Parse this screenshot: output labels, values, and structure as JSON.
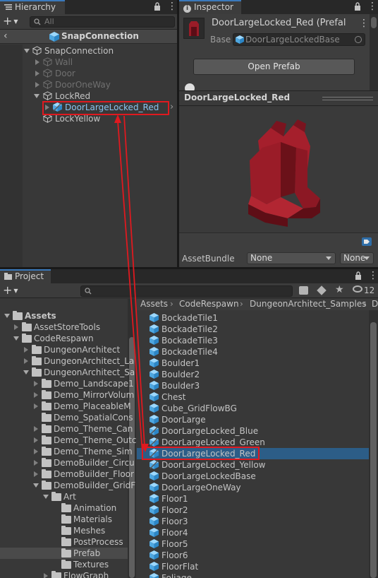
{
  "hierarchy": {
    "tab_label": "Hierarchy",
    "search_placeholder": "All",
    "scene_title": "SnapConnection",
    "items": [
      {
        "label": "SnapConnection"
      },
      {
        "label": "Wall"
      },
      {
        "label": "Door"
      },
      {
        "label": "DoorOneWay"
      },
      {
        "label": "LockRed"
      },
      {
        "label": "DoorLargeLocked_Red"
      },
      {
        "label": "LockYellow"
      }
    ]
  },
  "inspector": {
    "tab_label": "Inspector",
    "object_name": "DoorLargeLocked_Red (Prefal",
    "base_label": "Base",
    "base_value": "DoorLargeLockedBase",
    "open_prefab_label": "Open Prefab",
    "preview_title": "DoorLargeLocked_Red",
    "assetbundle_label": "AssetBundle",
    "assetbundle_value": "None",
    "variant_value": "None"
  },
  "project": {
    "tab_label": "Project",
    "hidden_count": "12",
    "breadcrumb": [
      "Assets",
      "CodeRespawn",
      "DungeonArchitect_Samples",
      "D"
    ],
    "tree": [
      {
        "label": "Assets",
        "bold": true
      },
      {
        "label": "AssetStoreTools"
      },
      {
        "label": "CodeRespawn"
      },
      {
        "label": "DungeonArchitect"
      },
      {
        "label": "DungeonArchitect_La"
      },
      {
        "label": "DungeonArchitect_Sa"
      },
      {
        "label": "Demo_Landscape1"
      },
      {
        "label": "Demo_MirrorVolum"
      },
      {
        "label": "Demo_PlaceableM"
      },
      {
        "label": "Demo_SpatialCons"
      },
      {
        "label": "Demo_Theme_Can"
      },
      {
        "label": "Demo_Theme_Outc"
      },
      {
        "label": "Demo_Theme_Sim"
      },
      {
        "label": "DemoBuilder_Circu"
      },
      {
        "label": "DemoBuilder_Floor"
      },
      {
        "label": "DemoBuilder_GridF"
      },
      {
        "label": "Art"
      },
      {
        "label": "Animation"
      },
      {
        "label": "Materials"
      },
      {
        "label": "Meshes"
      },
      {
        "label": "PostProcess"
      },
      {
        "label": "Prefab"
      },
      {
        "label": "Textures"
      },
      {
        "label": "FlowGraph"
      }
    ],
    "assets": [
      {
        "label": "BockadeTile1"
      },
      {
        "label": "BockadeTile2"
      },
      {
        "label": "BockadeTile3"
      },
      {
        "label": "BockadeTile4"
      },
      {
        "label": "Boulder1"
      },
      {
        "label": "Boulder2"
      },
      {
        "label": "Boulder3"
      },
      {
        "label": "Chest"
      },
      {
        "label": "Cube_GridFlowBG"
      },
      {
        "label": "DoorLarge"
      },
      {
        "label": "DoorLargeLocked_Blue"
      },
      {
        "label": "DoorLargeLocked_Green"
      },
      {
        "label": "DoorLargeLocked_Red"
      },
      {
        "label": "DoorLargeLocked_Yellow"
      },
      {
        "label": "DoorLargeLockedBase"
      },
      {
        "label": "DoorLargeOneWay"
      },
      {
        "label": "Floor1"
      },
      {
        "label": "Floor2"
      },
      {
        "label": "Floor3"
      },
      {
        "label": "Floor4"
      },
      {
        "label": "Floor5"
      },
      {
        "label": "Floor6"
      },
      {
        "label": "FloorFlat"
      },
      {
        "label": "Foliage"
      }
    ]
  },
  "colors": {
    "selection": "#2c5d87",
    "highlight_box": "#e0191f",
    "accent_tab": "#3a79bb",
    "prefab_icon": "#5fb8f0",
    "door_model": "#9a1c28"
  }
}
